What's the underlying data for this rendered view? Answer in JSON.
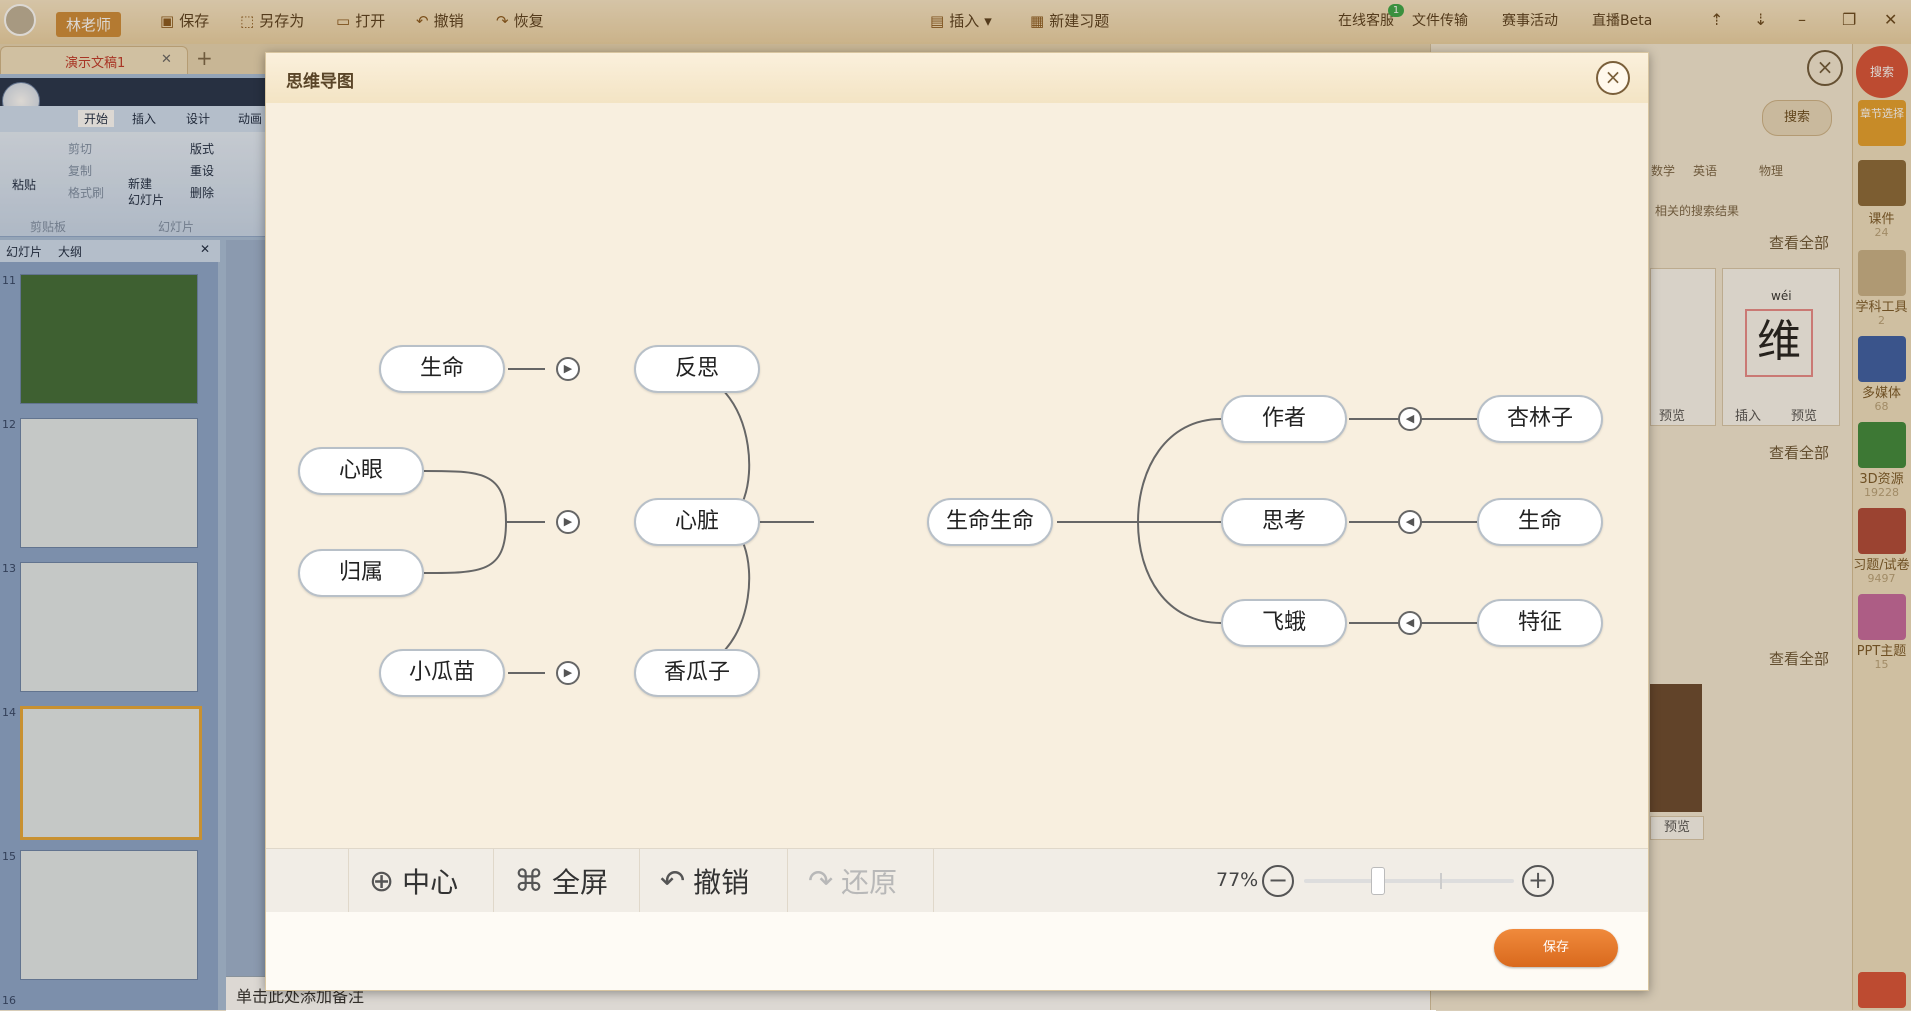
{
  "topbar": {
    "username": "林老师",
    "save": "保存",
    "saveas": "另存为",
    "open": "打开",
    "undo": "撤销",
    "redo": "恢复",
    "insert": "插入",
    "new_exercise": "新建习题",
    "online_service": "在线客服",
    "service_badge": "1",
    "file_transfer": "文件传输",
    "events": "赛事活动",
    "live": "直播Beta"
  },
  "doc_tab": {
    "title": "演示文稿1"
  },
  "ppt": {
    "tabs": [
      "开始",
      "插入",
      "设计",
      "动画"
    ],
    "ribbon": {
      "paste": "粘贴",
      "cut": "剪切",
      "copy": "复制",
      "format_painter": "格式刷",
      "new_slide": "新建\n幻灯片",
      "layout": "版式",
      "reset": "重设",
      "delete": "删除",
      "group_clipboard": "剪贴板",
      "group_slides": "幻灯片"
    },
    "panel_tabs": [
      "幻灯片",
      "大纲"
    ],
    "thumbs": [
      "11",
      "12",
      "13",
      "14",
      "15",
      "16"
    ],
    "notes_placeholder": "单击此处添加备注"
  },
  "resources": {
    "search_label": "搜索",
    "subjects": [
      "数学",
      "英语",
      "物理"
    ],
    "hint": "相关的搜索结果",
    "view_all": "查看全部",
    "card": {
      "pinyin": "wéi",
      "char": "维",
      "insert": "插入",
      "preview": "预览"
    },
    "card2_preview": "预览",
    "img_preview": "预览"
  },
  "sidebar": {
    "search": "搜索",
    "items": [
      {
        "label": "章节选择",
        "count": ""
      },
      {
        "label": "课件",
        "count": "24"
      },
      {
        "label": "学科工具",
        "count": "2"
      },
      {
        "label": "多媒体",
        "count": "68"
      },
      {
        "label": "3D资源",
        "count": "19228"
      },
      {
        "label": "习题/试卷",
        "count": "9497"
      },
      {
        "label": "PPT主题",
        "count": "15"
      }
    ]
  },
  "dialog": {
    "title": "思维导图",
    "toolbar": {
      "center": "中心",
      "fullscreen": "全屏",
      "undo": "撤销",
      "redo": "还原",
      "zoom": "77%",
      "zoom_fraction": 0.35
    },
    "save": "保存",
    "mindmap": {
      "root": "生命生命",
      "left_branches": [
        {
          "label": "反思",
          "children": [
            "生命"
          ]
        },
        {
          "label": "心脏",
          "children": [
            "心眼",
            "归属"
          ]
        },
        {
          "label": "香瓜子",
          "children": [
            "小瓜苗"
          ]
        }
      ],
      "right_branches": [
        {
          "label": "作者",
          "children": [
            "杏林子"
          ]
        },
        {
          "label": "思考",
          "children": [
            "生命"
          ]
        },
        {
          "label": "飞蛾",
          "children": [
            "特征"
          ]
        }
      ]
    }
  }
}
